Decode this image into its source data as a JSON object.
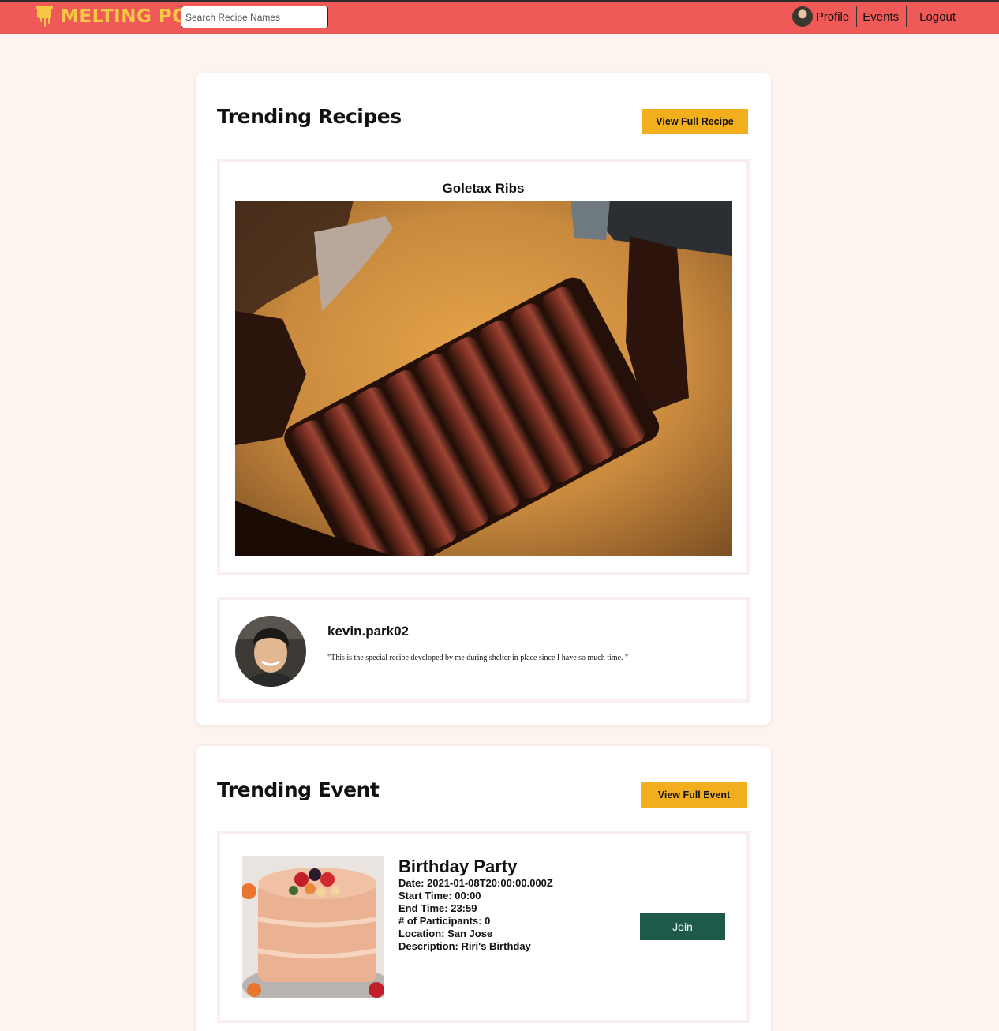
{
  "header": {
    "logo_text": "MELTING POT",
    "search_placeholder": "Search Recipe Names",
    "nav": {
      "profile": "Profile",
      "events": "Events",
      "logout": "Logout"
    }
  },
  "trending_recipes": {
    "title": "Trending Recipes",
    "view_button": "View Full Recipe",
    "recipe_name": "Goletax Ribs",
    "author": {
      "username": "kevin.park02",
      "quote": "\"This is the special recipe developed by me during shelter in place since I have so much time. \""
    }
  },
  "trending_event": {
    "title": "Trending Event",
    "view_button": "View Full Event",
    "event_name": "Birthday Party",
    "details": [
      "Date: 2021-01-08T20:00:00.000Z",
      "Start Time: 00:00",
      "End Time: 23:59",
      "# of Participants: 0",
      "Location: San Jose",
      "Description: Riri's Birthday"
    ],
    "join_button": "Join"
  },
  "colors": {
    "navbar": "#ef5a58",
    "logo": "#f7c844",
    "page_background": "#fdf4ef",
    "action_button": "#f2ae1c",
    "join_button": "#1d5a4a"
  }
}
